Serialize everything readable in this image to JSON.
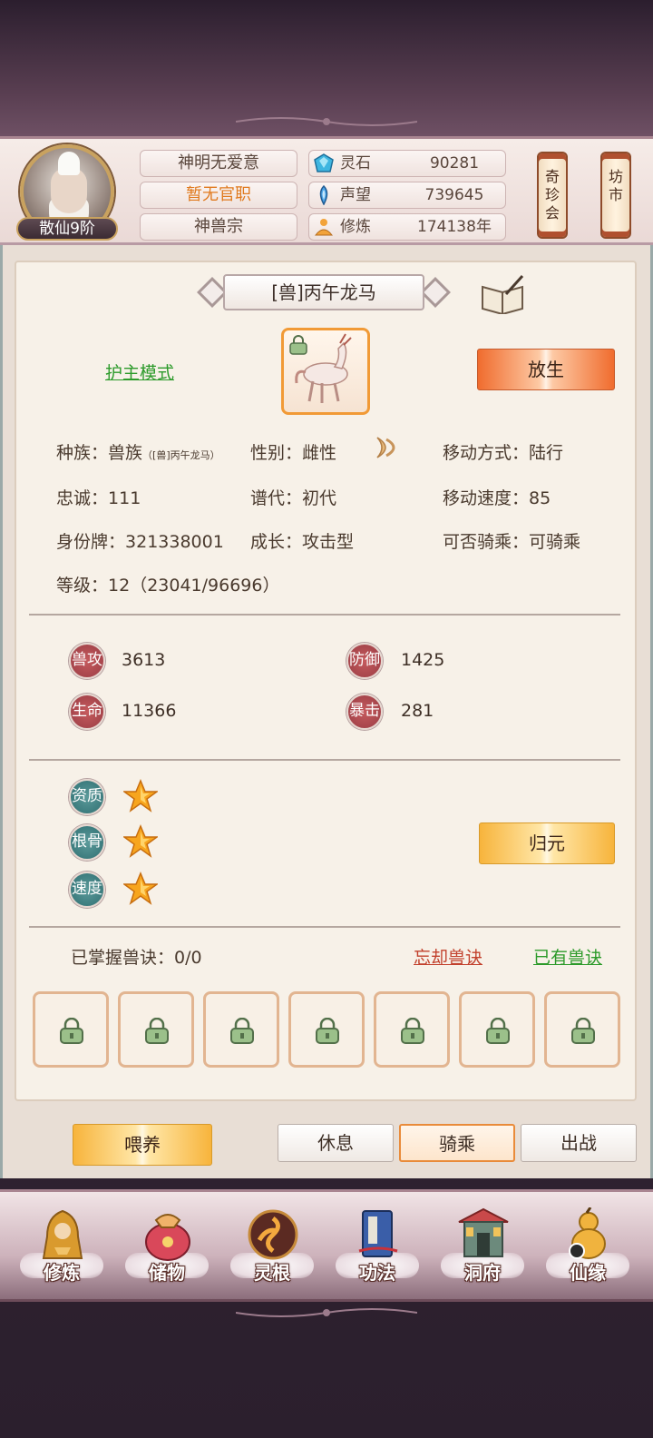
{
  "player": {
    "rank": "散仙9阶",
    "name_tag": "神明无爱意",
    "official_title": "暂无官职",
    "sect": "神兽宗",
    "resources": [
      {
        "icon": "spirit-stone-icon",
        "label": "灵石",
        "value": "90281"
      },
      {
        "icon": "reputation-icon",
        "label": "声望",
        "value": "739645"
      },
      {
        "icon": "cultivation-icon",
        "label": "修炼",
        "value": "174138年"
      }
    ],
    "side_buttons": [
      {
        "label": "奇珍会"
      },
      {
        "label": "坊市"
      }
    ]
  },
  "pet": {
    "title": "[兽]丙午龙马",
    "guard_mode_link": "护主模式",
    "release_button": "放生",
    "info": {
      "race_label": "种族：",
      "race_value": "兽族",
      "race_note": "[兽]丙午龙马",
      "gender_label": "性别：",
      "gender_value": "雌性",
      "move_label": "移动方式：",
      "move_value": "陆行",
      "loyalty_label": "忠诚：",
      "loyalty_value": "111",
      "gen_label": "谱代：",
      "gen_value": "初代",
      "speed_label": "移动速度：",
      "speed_value": "85",
      "id_label": "身份牌：",
      "id_value": "321338001",
      "growth_label": "成长：",
      "growth_value": "攻击型",
      "ride_label": "可否骑乘：",
      "ride_value": "可骑乘",
      "level_label": "等级：",
      "level_value": "12（23041/96696）"
    },
    "stats": [
      {
        "label": "兽攻",
        "value": "3613"
      },
      {
        "label": "防御",
        "value": "1425"
      },
      {
        "label": "生命",
        "value": "11366"
      },
      {
        "label": "暴击",
        "value": "281"
      }
    ],
    "qualities": [
      {
        "label": "资质",
        "stars": 1
      },
      {
        "label": "根骨",
        "stars": 1
      },
      {
        "label": "速度",
        "stars": 1
      }
    ],
    "reset_button": "归元",
    "skills": {
      "mastered_label": "已掌握兽诀：",
      "mastered_value": "0/0",
      "forget_link": "忘却兽诀",
      "owned_link": "已有兽诀",
      "slots": 7
    },
    "actions": {
      "feed": "喂养",
      "rest": "休息",
      "ride": "骑乘",
      "battle": "出战",
      "active_tab": "骑乘"
    }
  },
  "nav": [
    {
      "icon": "cultivate-icon",
      "label": "修炼"
    },
    {
      "icon": "storage-bag-icon",
      "label": "储物"
    },
    {
      "icon": "spirit-root-icon",
      "label": "灵根"
    },
    {
      "icon": "technique-book-icon",
      "label": "功法"
    },
    {
      "icon": "cave-mansion-icon",
      "label": "洞府"
    },
    {
      "icon": "fortune-gourd-icon",
      "label": "仙缘"
    }
  ],
  "colors": {
    "accent_orange": "#f06c2e",
    "accent_yellow": "#f7b43c",
    "link_green": "#2c9a2a",
    "link_red": "#c2412d",
    "stat_red": "#9a3d45",
    "stat_teal": "#2f6f72"
  }
}
